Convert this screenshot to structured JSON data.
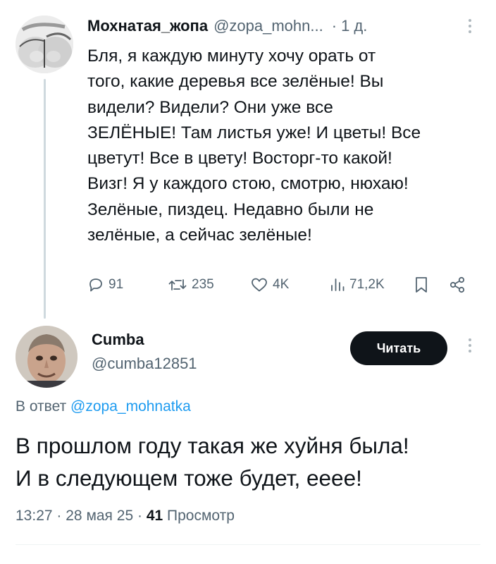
{
  "tweet": {
    "author_name": "Мохнатая_жопа",
    "author_handle": "@zopa_mohn...",
    "separator": "·",
    "time": "1 д.",
    "text": "Бля, я каждую минуту хочу орать от\nтого, какие деревья все зелёные! Вы\nвидели? Видели? Они уже все\nЗЕЛЁНЫЕ! Там листья уже! И цветы! Все\nцветут! Все в цвету! Восторг-то какой!\nВизг! Я у каждого стою, смотрю, нюхаю!\nЗелёные, пиздец. Недавно были не\nзелёные, а сейчас зелёные!",
    "actions": {
      "replies": "91",
      "retweets": "235",
      "likes": "4K",
      "views": "71,2K"
    },
    "icons": [
      "reply-icon",
      "retweet-icon",
      "like-icon",
      "views-icon",
      "bookmark-icon",
      "share-icon",
      "more-icon"
    ]
  },
  "reply": {
    "author_name": "Cumba",
    "author_handle": "@cumba12851",
    "follow_label": "Читать",
    "reply_prefix": "В ответ",
    "reply_mention": "@zopa_mohnatka",
    "text": "В прошлом году такая же хуйня была!\nИ в следующем тоже будет, ееее!",
    "time": "13:27",
    "sep1": "·",
    "date": "28 мая 25",
    "sep2": "·",
    "views_count": "41",
    "views_label": "Просмотр"
  },
  "colors": {
    "text": "#0f1419",
    "secondary": "#536471",
    "link": "#1d9bf0",
    "button_bg": "#0f1419",
    "thread_line": "#cfd9de"
  }
}
